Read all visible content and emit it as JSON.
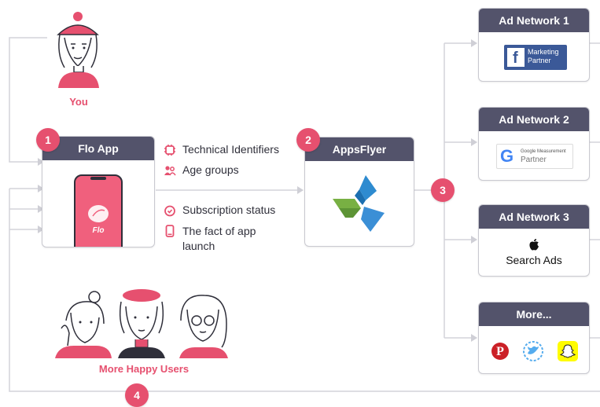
{
  "you_label": "You",
  "flo_app": {
    "badge": "1",
    "title": "Flo App",
    "phone_logo_text": "Flo"
  },
  "features": [
    {
      "icon": "chip-icon",
      "text": "Technical Identifiers"
    },
    {
      "icon": "people-icon",
      "text": "Age groups"
    },
    {
      "icon": "clock-icon",
      "text": "Subscription status"
    },
    {
      "icon": "phone-icon",
      "text": "The fact of app launch"
    }
  ],
  "appsflyer": {
    "badge": "2",
    "title": "AppsFlyer"
  },
  "badge3": "3",
  "badge4": "4",
  "ad_networks": [
    {
      "title": "Ad Network 1",
      "logo": "facebook-marketing-partner",
      "logo_line1": "Marketing",
      "logo_line2": "Partner"
    },
    {
      "title": "Ad Network 2",
      "logo": "google-measurement-partner",
      "logo_line1": "Google Measurement",
      "logo_line2": "Partner"
    },
    {
      "title": "Ad Network 3",
      "logo": "apple-search-ads",
      "logo_text": "Search Ads"
    },
    {
      "title": "More...",
      "logos": [
        "pinterest-icon",
        "twitter-icon",
        "snapchat-icon"
      ]
    }
  ],
  "happy_users_label": "More Happy Users",
  "colors": {
    "accent": "#e6506f",
    "header": "#53536b",
    "line": "#cfcfd6"
  }
}
